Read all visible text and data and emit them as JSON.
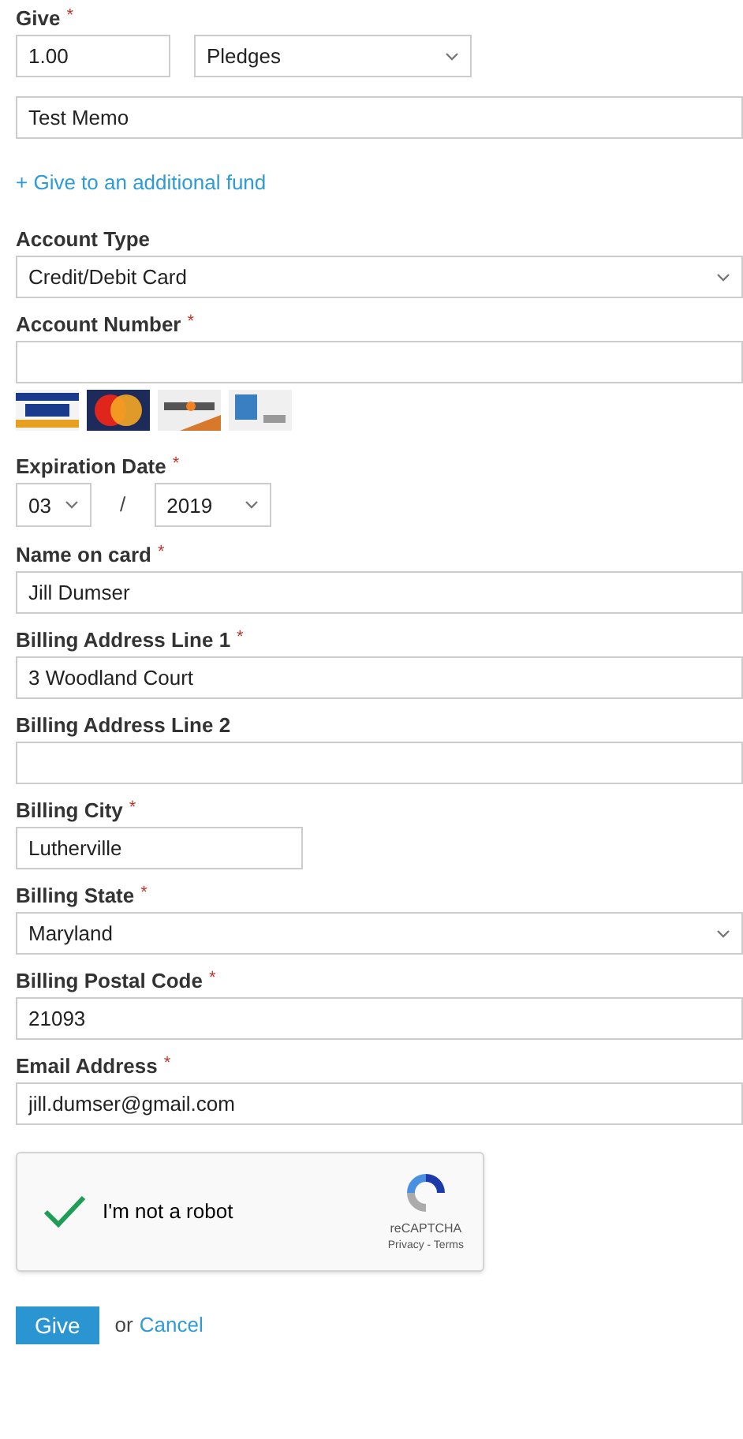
{
  "give": {
    "label": "Give",
    "required_mark": "*",
    "amount": "1.00",
    "fund": "Pledges",
    "memo": "Test Memo",
    "add_fund_link": "+ Give to an additional fund"
  },
  "fields": [
    {
      "kind": "select",
      "label": "Account Type",
      "value": "Credit/Debit Card"
    },
    {
      "kind": "text",
      "label": "Account Number",
      "required_mark": "*"
    },
    {
      "kind": "cards"
    },
    {
      "kind": "expiry",
      "label": "Expiration Date",
      "required_mark": "*",
      "month": "03",
      "separator": "/",
      "year": "2019"
    },
    {
      "kind": "text",
      "label": "Name on card",
      "required_mark": "*",
      "value": "Jill Dumser"
    },
    {
      "kind": "text",
      "label": "Billing Address Line 1",
      "required_mark": "*",
      "value": "3 Woodland Court"
    },
    {
      "kind": "text",
      "label": "Billing Address Line 2"
    },
    {
      "kind": "short",
      "label": "Billing City",
      "required_mark": "*",
      "value": "Lutherville"
    },
    {
      "kind": "select",
      "label": "Billing State",
      "required_mark": "*",
      "value": "Maryland"
    },
    {
      "kind": "text",
      "label": "Billing Postal Code",
      "required_mark": "*",
      "value": "21093"
    },
    {
      "kind": "text",
      "label": "Email Address",
      "required_mark": "*",
      "value": "jill.dumser@gmail.com"
    }
  ],
  "captcha": {
    "checked": true,
    "label": "I'm not a robot",
    "brand": "reCAPTCHA",
    "links": "Privacy - Terms"
  },
  "actions": {
    "submit": "Give",
    "or": "or",
    "cancel": "Cancel"
  }
}
